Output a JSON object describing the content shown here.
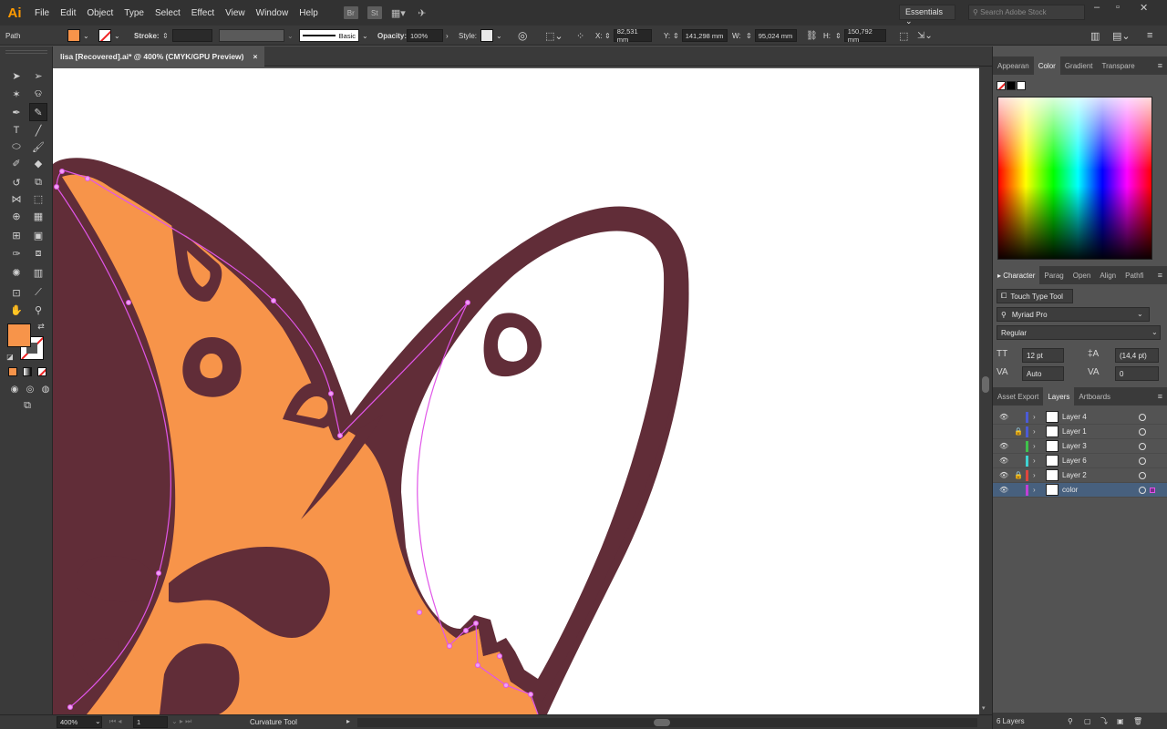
{
  "app": {
    "logo": "Ai"
  },
  "menu": [
    "File",
    "Edit",
    "Object",
    "Type",
    "Select",
    "Effect",
    "View",
    "Window",
    "Help"
  ],
  "menubar_icons": {
    "br": "Br",
    "st": "St"
  },
  "workspace": "Essentials",
  "search": {
    "placeholder": "Search Adobe Stock"
  },
  "control": {
    "selection": "Path",
    "fill_color": "#f7944a",
    "stroke_label": "Stroke:",
    "brush": "Basic",
    "opacity_label": "Opacity:",
    "opacity": "100%",
    "style_label": "Style:",
    "x_label": "X:",
    "x": "82,531 mm",
    "y_label": "Y:",
    "y": "141,298 mm",
    "w_label": "W:",
    "w": "95,024 mm",
    "h_label": "H:",
    "h": "150,792 mm"
  },
  "document_tab": {
    "title": "lisa [Recovered].ai* @ 400% (CMYK/GPU Preview)",
    "close": "×"
  },
  "status": {
    "zoom": "400%",
    "artboard": "1",
    "tool": "Curvature Tool"
  },
  "color_panel": {
    "tabs": [
      "Appearan",
      "Color",
      "Gradient",
      "Transpare"
    ],
    "active": 1
  },
  "character_panel": {
    "tabs": [
      "Character",
      "Parag",
      "Open",
      "Align",
      "Pathfi"
    ],
    "active": 0,
    "touch_type": "Touch Type Tool",
    "font": "Myriad Pro",
    "style": "Regular",
    "size": "12 pt",
    "leading": "(14,4 pt)",
    "kerning": "Auto",
    "tracking": "0"
  },
  "layers_panel": {
    "tabs": [
      "Asset Export",
      "Layers",
      "Artboards"
    ],
    "active": 1,
    "layers": [
      {
        "name": "Layer 4",
        "color": "#4b5bd6",
        "visible": true,
        "locked": false
      },
      {
        "name": "Layer 1",
        "color": "#4b5bd6",
        "visible": false,
        "locked": true
      },
      {
        "name": "Layer 3",
        "color": "#3fc24b",
        "visible": true,
        "locked": false
      },
      {
        "name": "Layer 6",
        "color": "#3fd3d3",
        "visible": true,
        "locked": false
      },
      {
        "name": "Layer 2",
        "color": "#e0453e",
        "visible": true,
        "locked": true
      },
      {
        "name": "color",
        "color": "#c13fd6",
        "visible": true,
        "locked": false
      }
    ],
    "count": "6 Layers"
  },
  "art_colors": {
    "orange": "#f7944a",
    "dark": "#612d38",
    "path": "#e055e8"
  }
}
